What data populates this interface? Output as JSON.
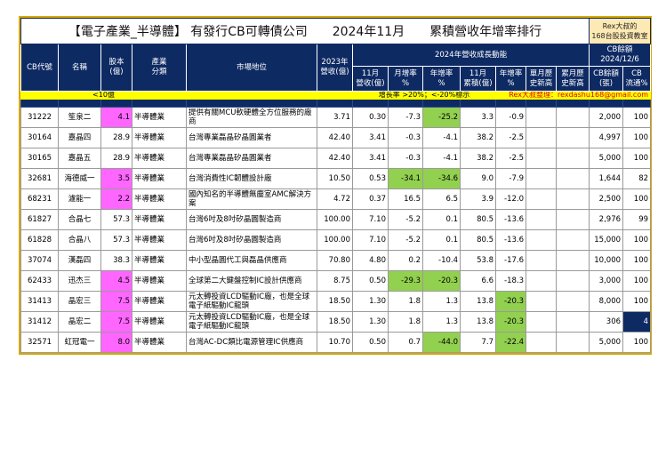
{
  "title": "【電子產業_半導體】 有發行CB可轉債公司　　2024年11月　　累積營收年增率排行",
  "badge": [
    "Rex大叔的",
    "168台股投資教室"
  ],
  "headers": {
    "code": "CB代號",
    "name": "名稱",
    "capital": "股本\n(億)",
    "industry": "產業\n分類",
    "position": "市場地位",
    "rev2023": "2023年\n營收(億)",
    "group2024": "2024年營收成長動能",
    "m11": "11月\n營收(億)",
    "mom": "月增率\n%",
    "yoy": "年增率\n%",
    "cum": "11月\n累積(億)",
    "cumyoy": "年增率\n%",
    "mhigh": "單月歷\n史新高",
    "chigh": "累月歷\n史新高",
    "cbgroup": "CB餘額\n2024/12/6",
    "cbbal": "CB餘額\n(張)",
    "cbpct": "CB\n流通%"
  },
  "legend": {
    "small": "<10億",
    "rate": "增長率 >20%；<-20%標示",
    "author": "Rex大叔整理：rexdashu168@gmail.com"
  },
  "colors": {
    "pink": "#ff66ff",
    "green": "#92d050",
    "navy": "#0e2a63",
    "yellow": "#ffff00"
  },
  "rows": [
    {
      "code": "31222",
      "name": "笙泉二",
      "capital": "4.1",
      "pink": true,
      "industry": "半導體業",
      "position": "提供有關MCU軟硬體全方位服務的廠商",
      "rev2023": "3.71",
      "m11": "0.30",
      "mom": "-7.3",
      "yoy": "-25.2",
      "cum": "3.3",
      "cumyoy": "-0.9",
      "cb": "2,000",
      "pct": "100",
      "g": [
        "yoy"
      ]
    },
    {
      "code": "30164",
      "name": "嘉晶四",
      "capital": "28.9",
      "industry": "半導體業",
      "position": "台灣專業磊晶矽晶圓業者",
      "rev2023": "42.40",
      "m11": "3.41",
      "mom": "-0.3",
      "yoy": "-4.1",
      "cum": "38.2",
      "cumyoy": "-2.5",
      "cb": "4,997",
      "pct": "100",
      "g": []
    },
    {
      "code": "30165",
      "name": "嘉晶五",
      "capital": "28.9",
      "industry": "半導體業",
      "position": "台灣專業磊晶矽晶圓業者",
      "rev2023": "42.40",
      "m11": "3.41",
      "mom": "-0.3",
      "yoy": "-4.1",
      "cum": "38.2",
      "cumyoy": "-2.5",
      "cb": "5,000",
      "pct": "100",
      "g": []
    },
    {
      "code": "32681",
      "name": "海德威一",
      "capital": "3.5",
      "pink": true,
      "industry": "半導體業",
      "position": "台灣消費性IC韌體設計廠",
      "rev2023": "10.50",
      "m11": "0.53",
      "mom": "-34.1",
      "yoy": "-34.6",
      "cum": "9.0",
      "cumyoy": "-7.9",
      "cb": "1,644",
      "pct": "82",
      "g": [
        "mom",
        "yoy"
      ]
    },
    {
      "code": "68231",
      "name": "濾能一",
      "capital": "2.2",
      "pink": true,
      "industry": "半導體業",
      "position": "國內知名的半導體無塵室AMC解決方案",
      "rev2023": "4.72",
      "m11": "0.37",
      "mom": "16.5",
      "yoy": "6.5",
      "cum": "3.9",
      "cumyoy": "-12.0",
      "cb": "2,500",
      "pct": "100",
      "g": []
    },
    {
      "code": "61827",
      "name": "合晶七",
      "capital": "57.3",
      "industry": "半導體業",
      "position": "台灣6吋及8吋矽晶圓製造商",
      "rev2023": "100.00",
      "m11": "7.10",
      "mom": "-5.2",
      "yoy": "0.1",
      "cum": "80.5",
      "cumyoy": "-13.6",
      "cb": "2,976",
      "pct": "99",
      "g": []
    },
    {
      "code": "61828",
      "name": "合晶八",
      "capital": "57.3",
      "industry": "半導體業",
      "position": "台灣6吋及8吋矽晶圓製造商",
      "rev2023": "100.00",
      "m11": "7.10",
      "mom": "-5.2",
      "yoy": "0.1",
      "cum": "80.5",
      "cumyoy": "-13.6",
      "cb": "15,000",
      "pct": "100",
      "g": []
    },
    {
      "code": "37074",
      "name": "漢磊四",
      "capital": "38.3",
      "industry": "半導體業",
      "position": "中小型晶圓代工與磊晶供應商",
      "rev2023": "70.80",
      "m11": "4.80",
      "mom": "0.2",
      "yoy": "-10.4",
      "cum": "53.8",
      "cumyoy": "-17.6",
      "cb": "10,000",
      "pct": "100",
      "g": []
    },
    {
      "code": "62433",
      "name": "迅杰三",
      "capital": "4.5",
      "pink": true,
      "industry": "半導體業",
      "position": "全球第二大鍵盤控制IC設計供應商",
      "rev2023": "8.75",
      "m11": "0.50",
      "mom": "-29.3",
      "yoy": "-20.3",
      "cum": "6.6",
      "cumyoy": "-18.3",
      "cb": "3,000",
      "pct": "100",
      "g": [
        "mom",
        "yoy"
      ]
    },
    {
      "code": "31413",
      "name": "晶宏三",
      "capital": "7.5",
      "pink": true,
      "industry": "半導體業",
      "position": "元太轉投資LCD驅動IC廠，也是全球電子紙驅動IC龍頭",
      "rev2023": "18.50",
      "m11": "1.30",
      "mom": "1.8",
      "yoy": "1.3",
      "cum": "13.8",
      "cumyoy": "-20.3",
      "cb": "8,000",
      "pct": "100",
      "g": [
        "cumyoy"
      ]
    },
    {
      "code": "31412",
      "name": "晶宏二",
      "capital": "7.5",
      "pink": true,
      "industry": "半導體業",
      "position": "元太轉投資LCD驅動IC廠，也是全球電子紙驅動IC龍頭",
      "rev2023": "18.50",
      "m11": "1.30",
      "mom": "1.8",
      "yoy": "1.3",
      "cum": "13.8",
      "cumyoy": "-20.3",
      "cb": "306",
      "pct": "4",
      "navy": true,
      "g": [
        "cumyoy"
      ]
    },
    {
      "code": "32571",
      "name": "虹冠電一",
      "capital": "8.0",
      "pink": true,
      "industry": "半導體業",
      "position": "台灣AC-DC類比電源管理IC供應商",
      "rev2023": "10.70",
      "m11": "0.50",
      "mom": "0.7",
      "yoy": "-44.0",
      "cum": "7.7",
      "cumyoy": "-22.4",
      "cb": "5,000",
      "pct": "100",
      "g": [
        "yoy",
        "cumyoy"
      ]
    }
  ]
}
